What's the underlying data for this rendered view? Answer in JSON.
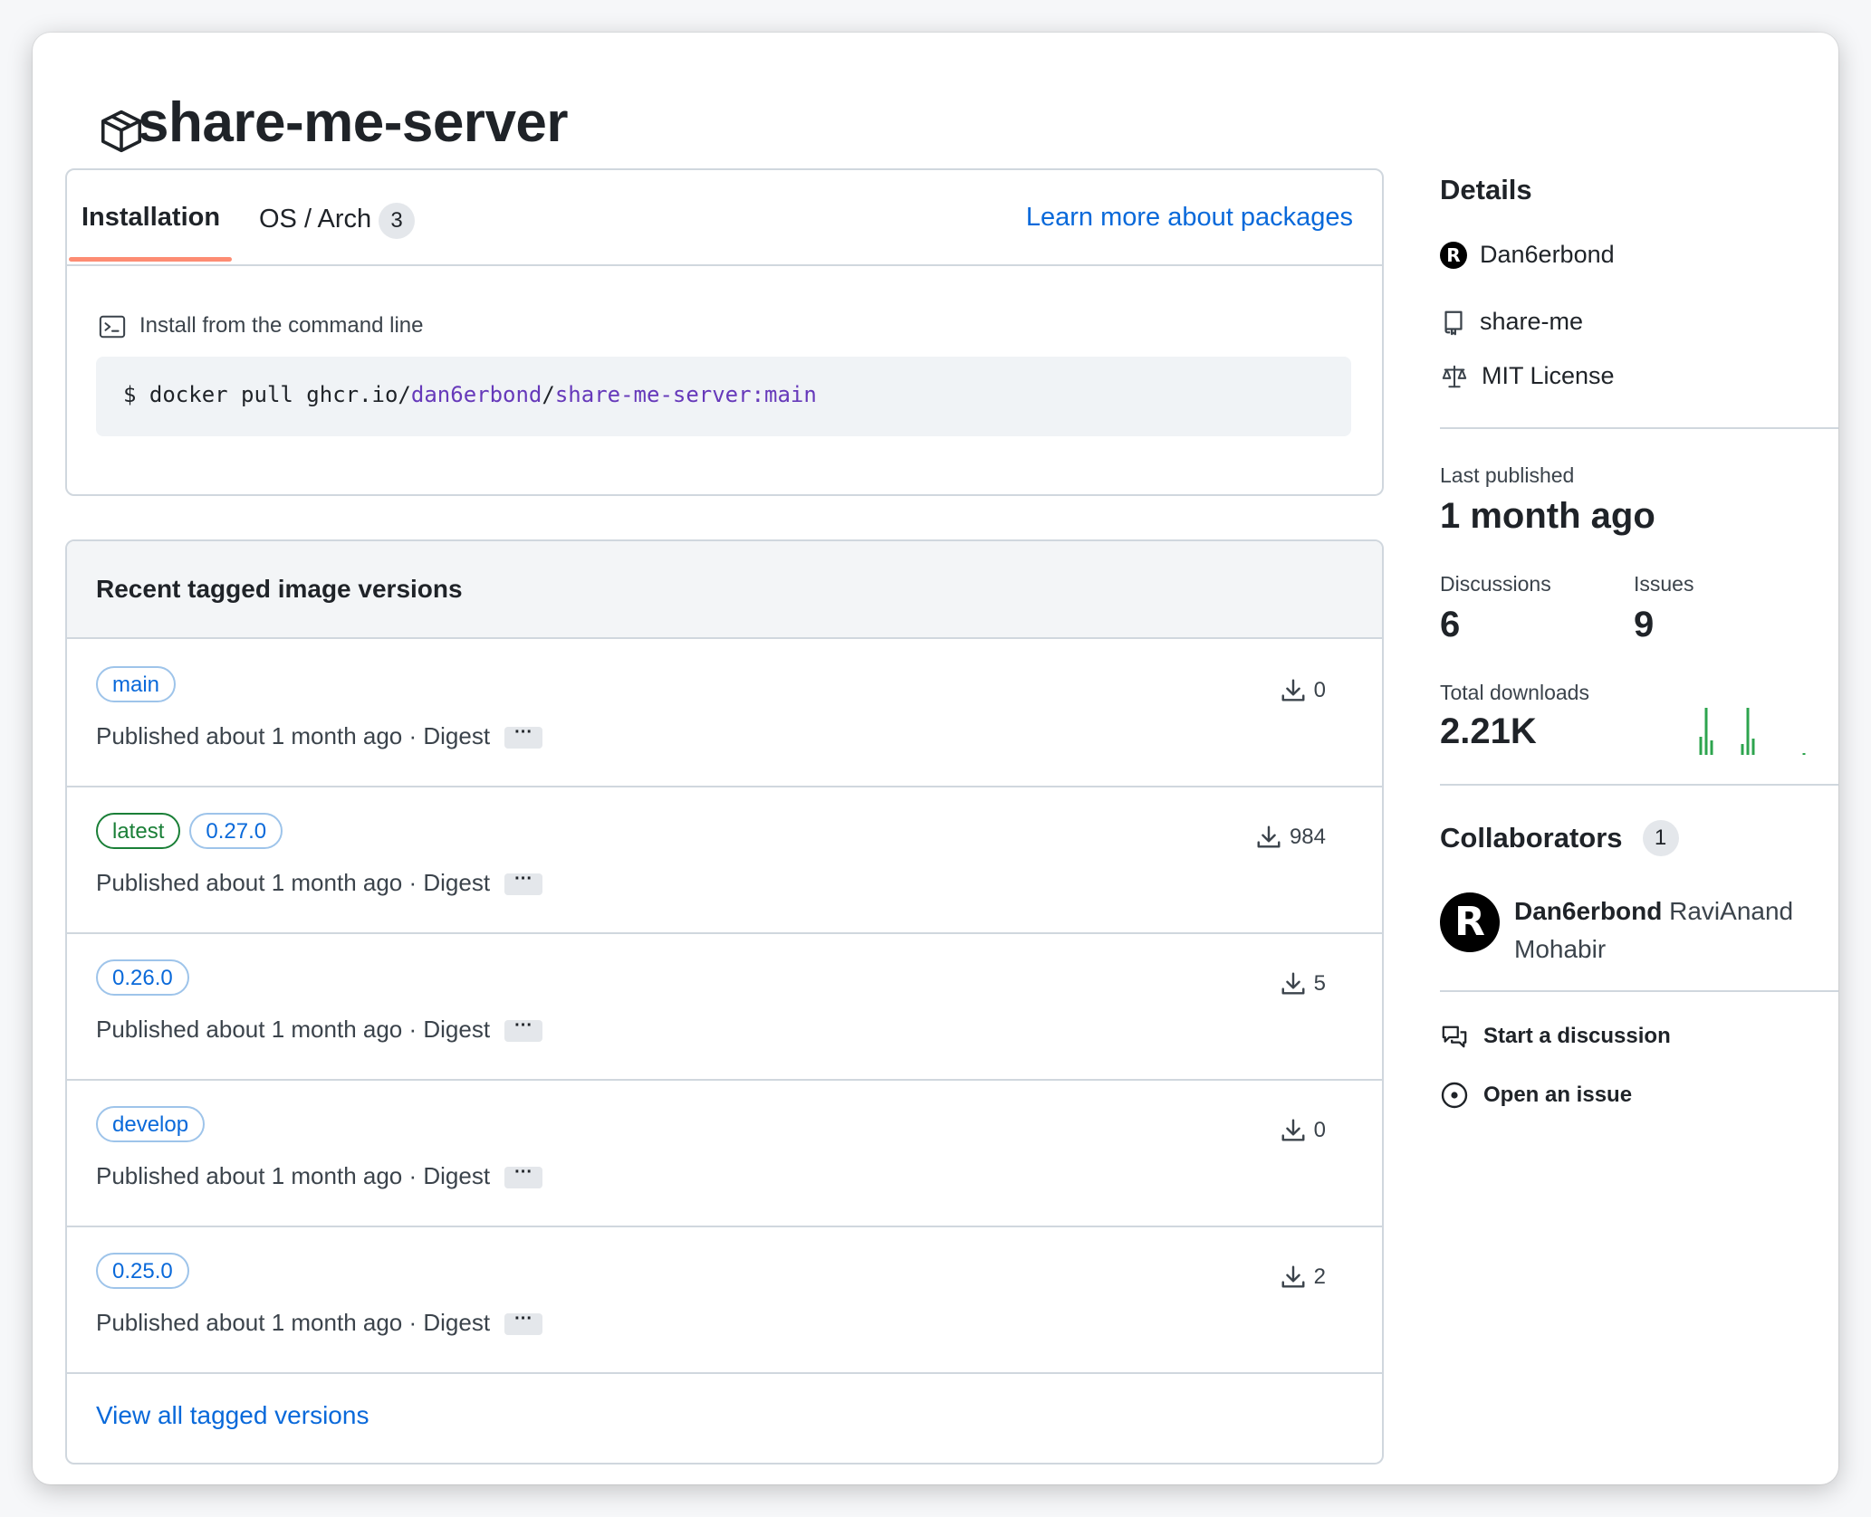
{
  "page": {
    "title": "share-me-server"
  },
  "tabs": {
    "installation": "Installation",
    "os_arch": "OS / Arch",
    "os_arch_count": "3",
    "learn_more": "Learn more about packages"
  },
  "install": {
    "label": "Install from the command line",
    "cmd_prefix": "$ docker pull ghcr.io/",
    "cmd_owner": "dan6erbond",
    "cmd_sep": "/",
    "cmd_image": "share-me-server:main"
  },
  "versions": {
    "title": "Recent tagged image versions",
    "rows": [
      {
        "tags": [
          "main"
        ],
        "published": "Published about 1 month ago · Digest",
        "downloads": "0"
      },
      {
        "tags": [
          "latest",
          "0.27.0"
        ],
        "published": "Published about 1 month ago · Digest",
        "downloads": "984"
      },
      {
        "tags": [
          "0.26.0"
        ],
        "published": "Published about 1 month ago · Digest",
        "downloads": "5"
      },
      {
        "tags": [
          "develop"
        ],
        "published": "Published about 1 month ago · Digest",
        "downloads": "0"
      },
      {
        "tags": [
          "0.25.0"
        ],
        "published": "Published about 1 month ago · Digest",
        "downloads": "2"
      }
    ],
    "ellipsis": "···",
    "view_all": "View all tagged versions"
  },
  "details": {
    "title": "Details",
    "owner": "Dan6erbond",
    "repo": "share-me",
    "license": "MIT License",
    "avatar_letter": "R"
  },
  "stats": {
    "last_published_label": "Last published",
    "last_published_value": "1 month ago",
    "discussions_label": "Discussions",
    "discussions_value": "6",
    "issues_label": "Issues",
    "issues_value": "9",
    "downloads_label": "Total downloads",
    "downloads_value": "2.21K",
    "sparkline_color": "#2da44e"
  },
  "collaborators": {
    "title": "Collaborators",
    "count": "1",
    "username": "Dan6erbond",
    "fullname_1": "RaviAnand",
    "fullname_2": "Mohabir"
  },
  "actions": {
    "start_discussion": "Start a discussion",
    "open_issue": "Open an issue"
  },
  "colors": {
    "link": "#0969da",
    "tab_underline": "#fd8c73",
    "tag_green": "#1a7f37",
    "code_purple": "#6639ba"
  }
}
